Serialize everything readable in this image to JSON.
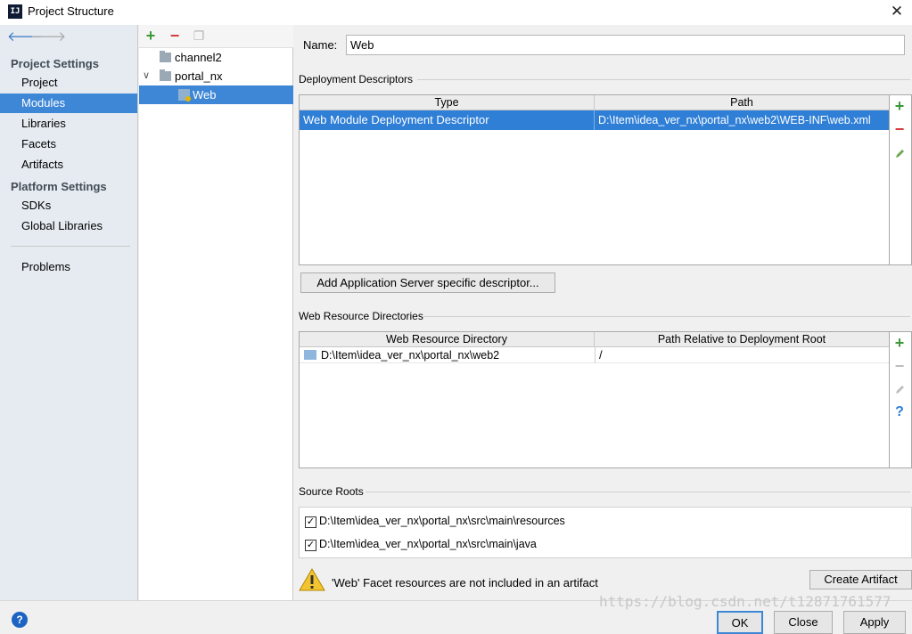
{
  "window": {
    "title": "Project Structure",
    "app_icon_text": "IJ",
    "close_glyph": "✕"
  },
  "nav": {
    "back_glyph": "🡐",
    "forward_glyph": "🡒",
    "project_settings_heading": "Project Settings",
    "project_settings_items": [
      "Project",
      "Modules",
      "Libraries",
      "Facets",
      "Artifacts"
    ],
    "platform_settings_heading": "Platform Settings",
    "platform_settings_items": [
      "SDKs",
      "Global Libraries"
    ],
    "problems": "Problems",
    "selected": "Modules"
  },
  "tree": {
    "add_glyph": "+",
    "remove_glyph": "−",
    "copy_glyph": "❐",
    "nodes": [
      "channel2",
      "portal_nx",
      "Web"
    ],
    "expanded_glyph": "∨",
    "selected": "Web"
  },
  "form": {
    "name_label": "Name:",
    "name_value": "Web"
  },
  "deployment": {
    "heading": "Deployment Descriptors",
    "columns": [
      "Type",
      "Path"
    ],
    "rows": [
      {
        "type": "Web Module Deployment Descriptor",
        "path": "D:\\Item\\idea_ver_nx\\portal_nx\\web2\\WEB-INF\\web.xml"
      }
    ],
    "add_server_descriptor_button": "Add Application Server specific descriptor..."
  },
  "web_resources": {
    "heading": "Web Resource Directories",
    "columns": [
      "Web Resource Directory",
      "Path Relative to Deployment Root"
    ],
    "rows": [
      {
        "directory": "D:\\Item\\idea_ver_nx\\portal_nx\\web2",
        "relative": "/"
      }
    ],
    "help_glyph": "?"
  },
  "source_roots": {
    "heading": "Source Roots",
    "items": [
      {
        "checked": true,
        "path": "D:\\Item\\idea_ver_nx\\portal_nx\\src\\main\\resources"
      },
      {
        "checked": true,
        "path": "D:\\Item\\idea_ver_nx\\portal_nx\\src\\main\\java"
      }
    ],
    "check_glyph": "✓"
  },
  "warning": {
    "message": "'Web' Facet resources are not included in an artifact",
    "create_artifact_button": "Create Artifact"
  },
  "dialog_buttons": {
    "ok": "OK",
    "close": "Close",
    "apply": "Apply",
    "help": "?"
  },
  "watermark": "https://blog.csdn.net/t12871761577",
  "colors": {
    "selection": "#3e87d6",
    "add_green": "#3a9a3a",
    "remove_red": "#d23b3b",
    "edit_green": "#6aa84f"
  }
}
